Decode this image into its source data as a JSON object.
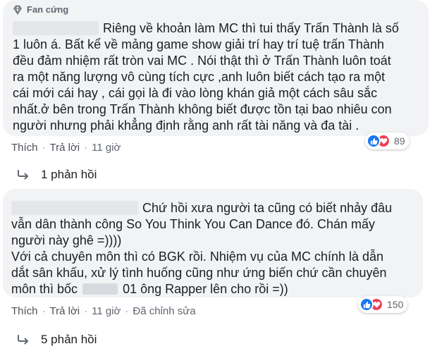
{
  "comment1": {
    "badge_label": "Fan cứng",
    "lines": [
      "Riêng về khoản làm MC thì tui thấy Trấn Thành là số",
      "1 luôn á. Bất kể về mảng game show giải trí hay trí tuệ trấn Thành",
      "đều đảm nhiệm rất tròn vai MC . Nói thật thì ở Trấn Thành luôn toát",
      "ra một năng lượng vô cùng tích cực ,anh luôn biết cách tạo ra một",
      "cái mới cái hay , cái gọi là đi vào lòng khán giả một cách sâu sắc",
      "nhất.ở bên trong Trấn Thành không biết được tồn tại bao nhiêu con",
      "người nhưng phải khẳng định rằng anh rất tài năng và đa tài ."
    ],
    "actions": {
      "like": "Thích",
      "reply": "Trả lời",
      "time": "11 giờ"
    },
    "reaction_count": "89",
    "replies_label": "1 phản hồi"
  },
  "comment2": {
    "lines": [
      "Chứ hồi xưa người ta cũng có biết nhảy đâu",
      "vẫn dân thành công So You Think You Can Dance đó. Chán mấy",
      "người này ghê =))))",
      "Với cả chuyên môn thì có BGK rồi. Nhiệm vụ của MC chính là dẫn",
      "dắt sân khấu, xử lý tình huống cũng như ứng biến chứ cần chuyên",
      "môn thì bốc",
      "01 ông Rapper lên cho rồi =))"
    ],
    "actions": {
      "like": "Thích",
      "reply": "Trả lời",
      "time": "11 giờ",
      "edited": "Đã chỉnh sửa"
    },
    "reaction_count": "150",
    "replies_label": "5 phản hồi"
  },
  "colors": {
    "bubble": "#f2f3f5",
    "like": "#1877f2",
    "love": "#f33e58",
    "link": "#4b4f56"
  }
}
